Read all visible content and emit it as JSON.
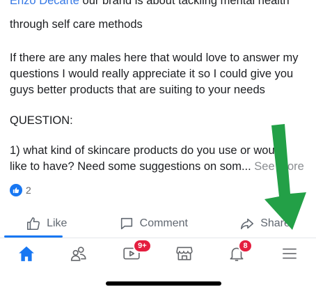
{
  "post": {
    "author": "Enzo Decarte",
    "line1_rest": " our brand is about tackling mental health",
    "line2": "through self care methods",
    "para2_l1": "If there are any males here that would love to answer my",
    "para2_l2": "questions I would really appreciate it so I could give you",
    "para2_l3": "guys better products that are suiting  to your needs",
    "question_heading": "QUESTION:",
    "q1_l1": "1) what kind of skincare products do you use or would",
    "q1_l2": "like to have? Need some suggestions on som...",
    "see_more": "See more"
  },
  "reactions": {
    "count": "2",
    "icon": "like-icon"
  },
  "actions": {
    "like": "Like",
    "comment": "Comment",
    "share": "Share"
  },
  "nav": {
    "watch_badge": "9+",
    "notifications_badge": "8",
    "icons": [
      "home-icon",
      "friends-icon",
      "watch-icon",
      "marketplace-icon",
      "notifications-icon",
      "menu-icon"
    ]
  },
  "colors": {
    "accent": "#1877f2",
    "arrow": "#23a047",
    "badge": "#e41e3f"
  }
}
